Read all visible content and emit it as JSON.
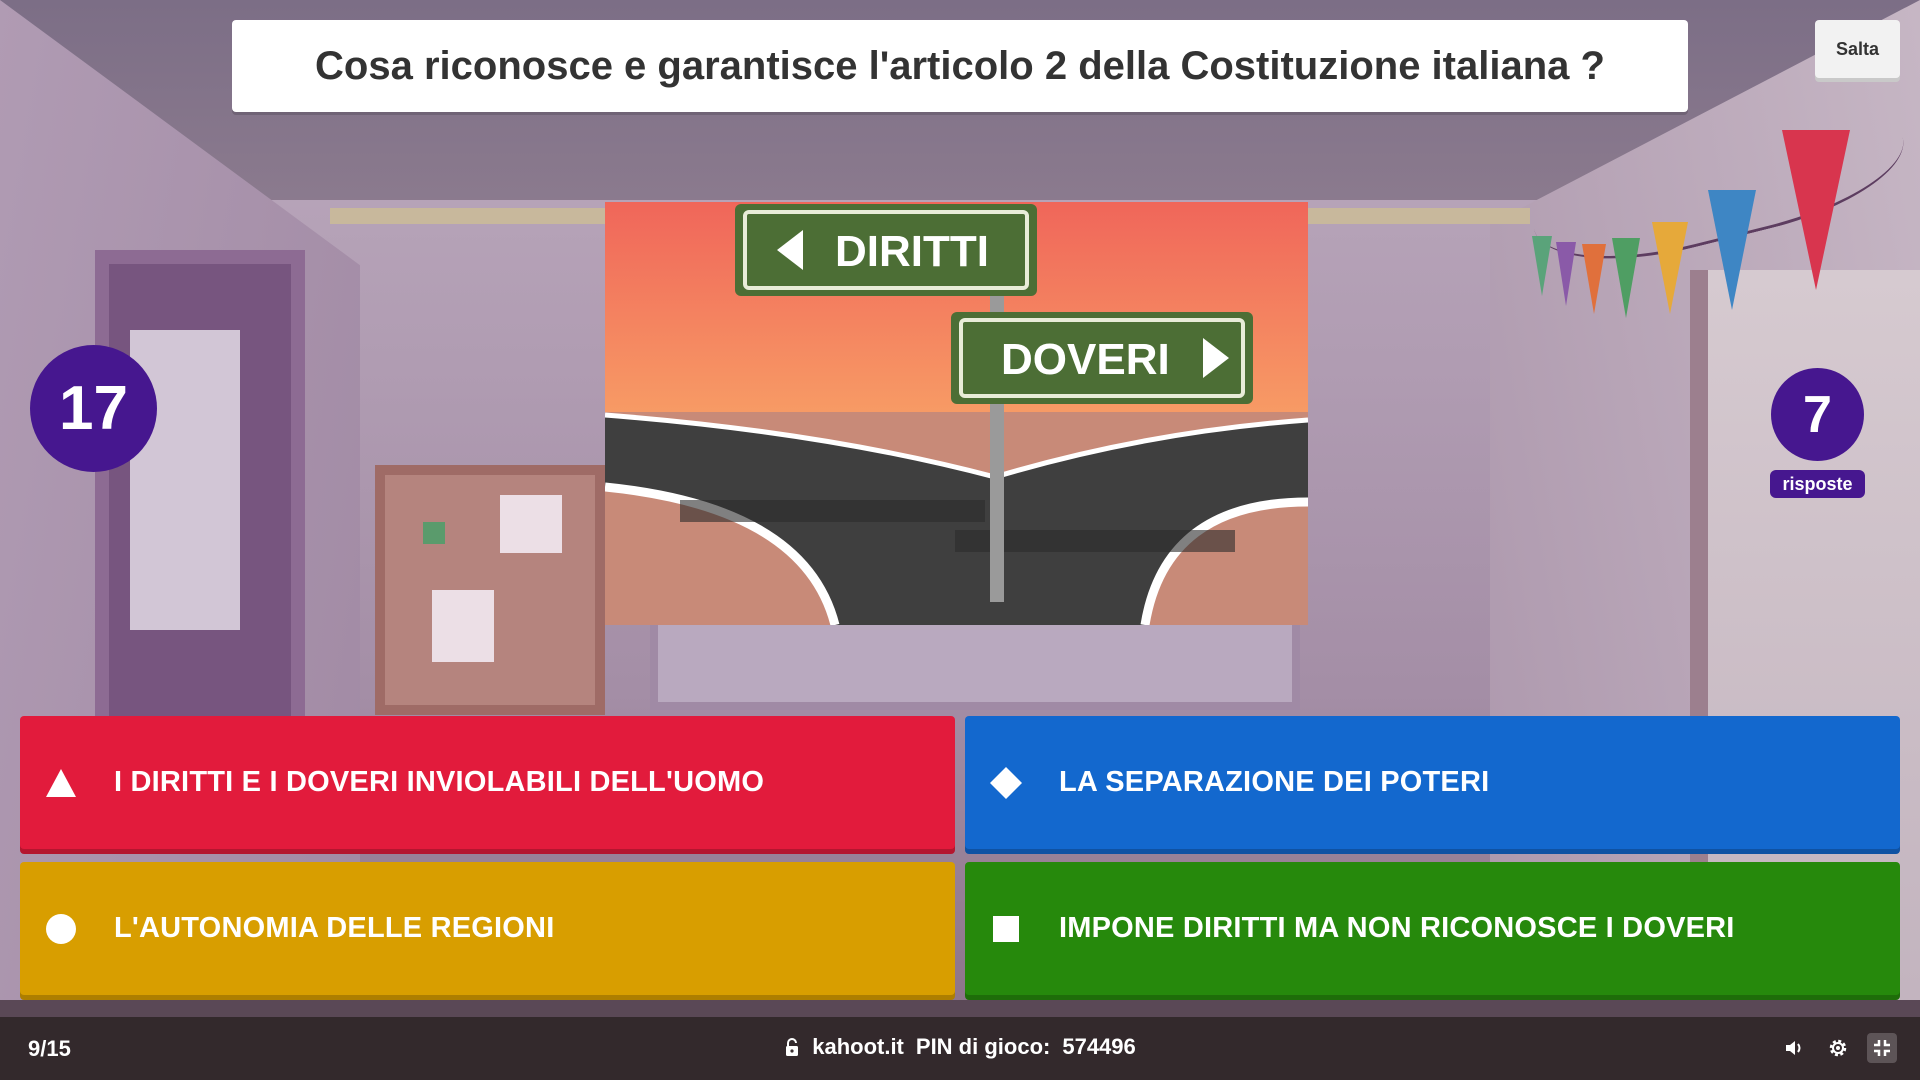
{
  "question": {
    "text": "Cosa riconosce e garantisce l'articolo 2 della Costituzione italiana ?",
    "skip_label": "Salta"
  },
  "timer": {
    "seconds": "17"
  },
  "answers_received": {
    "count": "7",
    "label": "risposte"
  },
  "image": {
    "sign_left": "DIRITTI",
    "sign_right": "DOVERI"
  },
  "answers": [
    {
      "shape": "triangle-icon",
      "label": "I DIRITTI E I DOVERI INVIOLABILI DELL'UOMO",
      "color": "#e21b3c"
    },
    {
      "shape": "diamond-icon",
      "label": "LA SEPARAZIONE DEI POTERI",
      "color": "#1368ce"
    },
    {
      "shape": "circle-icon",
      "label": "L'AUTONOMIA DELLE REGIONI",
      "color": "#d89e00"
    },
    {
      "shape": "square-icon",
      "label": "IMPONE DIRITTI MA NON RICONOSCE I DOVERI",
      "color": "#26890c"
    }
  ],
  "bottom_bar": {
    "progress": "9/15",
    "site": "kahoot.it",
    "pin_label": "PIN di gioco:",
    "pin": "574496",
    "icons": [
      "lock-icon",
      "volume-icon",
      "settings-icon",
      "fullscreen-exit-icon"
    ]
  },
  "colors": {
    "kahoot_purple": "#46178f",
    "red": "#e21b3c",
    "blue": "#1368ce",
    "yellow": "#d89e00",
    "green": "#26890c"
  }
}
